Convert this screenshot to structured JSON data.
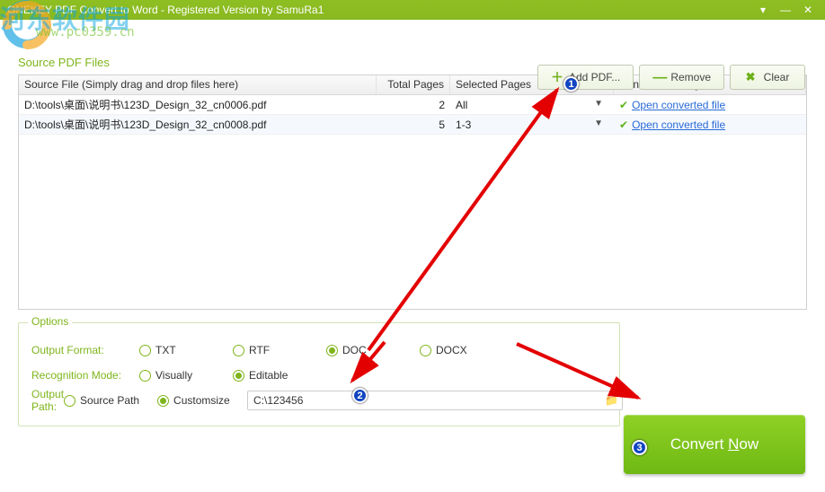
{
  "window": {
    "title": "ONEKEY PDF Convert to Word - Registered Version by SamuRa1"
  },
  "watermark": {
    "text1": "河东软件园",
    "text2": "www.pc0359.cn"
  },
  "section": {
    "sourceLabel": "Source PDF Files"
  },
  "toolbar": {
    "addpdf": "Add PDF...",
    "remove": "Remove",
    "clear": "Clear"
  },
  "table": {
    "headers": {
      "file": "Source File (Simply drag and drop files here)",
      "total": "Total Pages",
      "selected": "Selected Pages",
      "progress": "Conversion Progress"
    },
    "rows": [
      {
        "file": "D:\\tools\\桌面\\说明书\\123D_Design_32_cn0006.pdf",
        "total": "2",
        "selected": "All",
        "link": "Open converted file"
      },
      {
        "file": "D:\\tools\\桌面\\说明书\\123D_Design_32_cn0008.pdf",
        "total": "5",
        "selected": "1-3",
        "link": "Open converted file"
      }
    ]
  },
  "options": {
    "legend": "Options",
    "formatLabel": "Output Format:",
    "formats": {
      "txt": "TXT",
      "rtf": "RTF",
      "doc": "DOC",
      "docx": "DOCX",
      "selected": "doc"
    },
    "recogLabel": "Recognition Mode:",
    "recog": {
      "visually": "Visually",
      "editable": "Editable",
      "selected": "editable"
    },
    "pathLabel": "Output Path:",
    "path": {
      "source": "Source Path",
      "custom": "Customsize",
      "selected": "custom",
      "value": "C:\\123456"
    }
  },
  "convert": {
    "pre": "Convert ",
    "key": "N",
    "post": "ow"
  },
  "badges": {
    "b1": "1",
    "b2": "2",
    "b3": "3"
  }
}
